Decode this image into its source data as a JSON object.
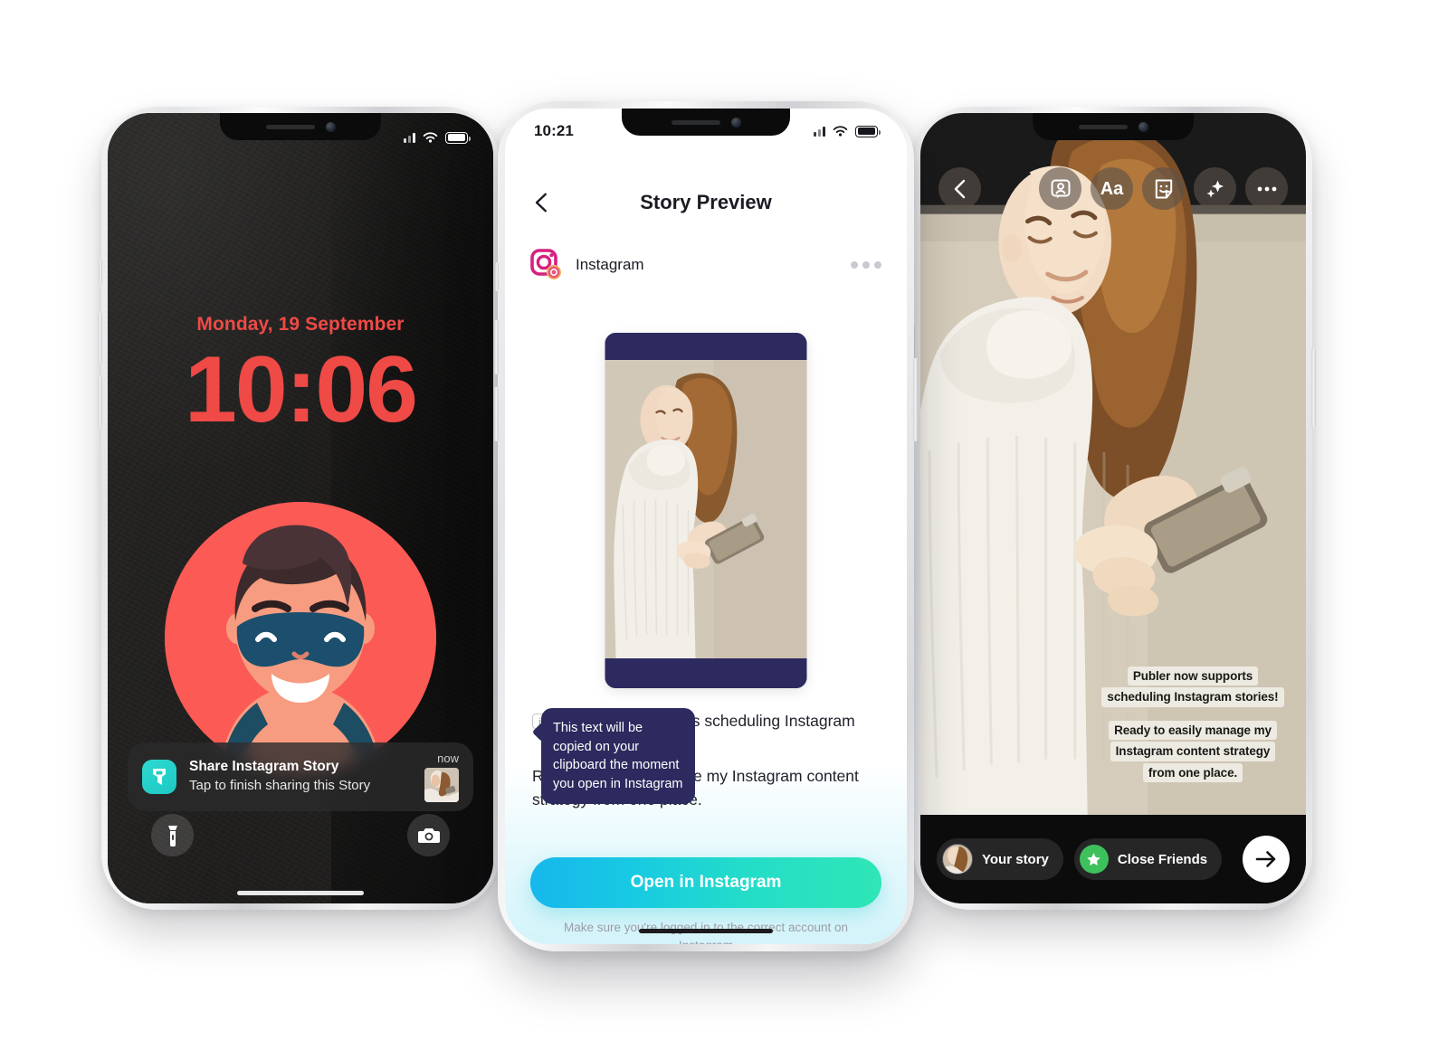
{
  "phone1": {
    "status": {
      "signal_icon": "signal-bars-icon",
      "wifi_icon": "wifi-icon",
      "battery_icon": "battery-icon"
    },
    "lock": {
      "date": "Monday, 19 September",
      "time": "10:06",
      "accent_color": "#ef4a46",
      "wallpaper": "dark-textured-wallpaper",
      "avatar_alt": "masked-superhero-avatar"
    },
    "notification": {
      "app_icon": "publer-app-icon",
      "title": "Share Instagram Story",
      "subtitle": "Tap to finish sharing this Story",
      "time": "now",
      "thumbnail_alt": "story-thumbnail"
    },
    "actions": [
      {
        "name": "flashlight-button",
        "icon": "flashlight-icon"
      },
      {
        "name": "camera-button",
        "icon": "camera-icon"
      }
    ]
  },
  "phone2": {
    "status": {
      "time": "10:21",
      "signal_icon": "signal-bars-icon",
      "wifi_icon": "wifi-icon",
      "battery_icon": "battery-icon"
    },
    "nav": {
      "back_icon": "back-chevron-icon",
      "title": "Story Preview"
    },
    "account": {
      "avatar_icon": "instagram-logo-icon",
      "name": "Instagram",
      "menu_icon": "more-options-icon"
    },
    "preview": {
      "alt": "story-preview-image",
      "frame_color": "#2c2a5e"
    },
    "caption": {
      "info_icon": "info-icon",
      "line1": "Publer now supports scheduling Instagram stories!",
      "line2": "Ready to easily manage my Instagram content strategy from one place."
    },
    "tooltip": {
      "text": "This text will be copied on your clipboard the moment you open in Instagram",
      "color": "#2c2a5e"
    },
    "cta": {
      "label": "Open in Instagram",
      "note": "Make sure you're logged in to the correct account on Instagram",
      "gradient_from": "#17b7ec",
      "gradient_to": "#2fe6b6"
    }
  },
  "phone3": {
    "toolbar": [
      {
        "name": "back-button",
        "icon": "back-chevron-icon"
      },
      {
        "name": "sticker-profile-button",
        "icon": "profile-card-icon"
      },
      {
        "name": "text-tool-button",
        "icon": "text-aa-icon"
      },
      {
        "name": "sticker-button",
        "icon": "smiley-sticker-icon"
      },
      {
        "name": "effects-button",
        "icon": "sparkles-icon"
      },
      {
        "name": "more-button",
        "icon": "more-options-icon"
      }
    ],
    "overlay": {
      "block1": [
        "Publer now supports",
        "scheduling Instagram stories!"
      ],
      "block2": [
        "Ready to easily manage my",
        "Instagram content strategy",
        "from one place."
      ]
    },
    "footer": {
      "your_story_label": "Your story",
      "your_story_avatar": "user-avatar",
      "close_friends_label": "Close Friends",
      "close_friends_icon": "green-star-icon",
      "send_icon": "arrow-right-icon"
    }
  }
}
